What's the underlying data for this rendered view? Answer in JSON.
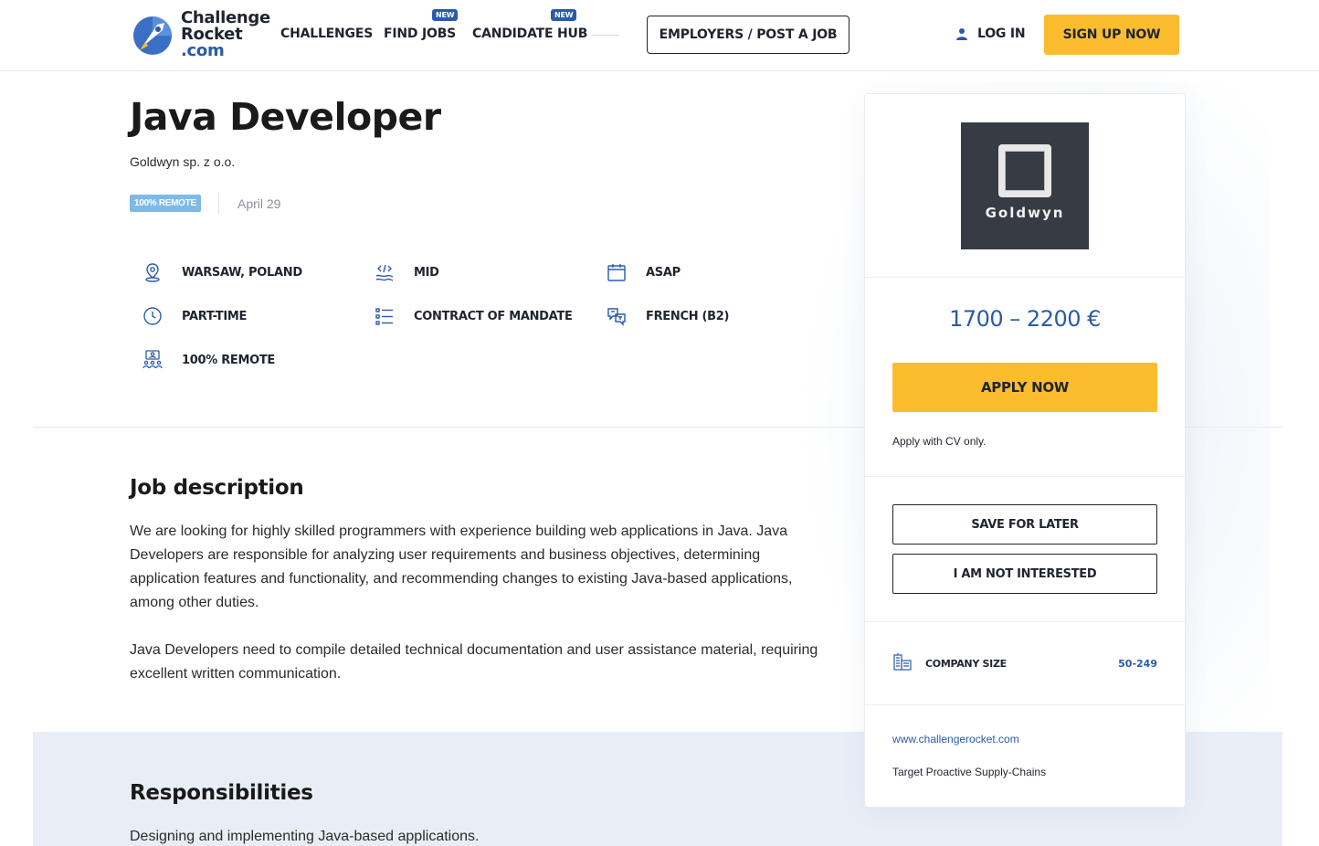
{
  "header": {
    "logo": {
      "line1": "Challenge",
      "line2": "Rocket",
      "line3": ".com"
    },
    "nav": [
      {
        "label": "CHALLENGES",
        "badge": ""
      },
      {
        "label": "FIND JOBS",
        "badge": "NEW"
      },
      {
        "label": "CANDIDATE HUB",
        "badge": "NEW"
      }
    ],
    "employers_label": "EMPLOYERS / POST A JOB",
    "login_label": "LOG IN",
    "signup_label": "SIGN UP NOW"
  },
  "job": {
    "title": "Java Developer",
    "company": "Goldwyn sp. z o.o.",
    "remote_badge": "100% REMOTE",
    "date": "April 29",
    "attributes": {
      "location": "WARSAW, POLAND",
      "seniority": "MID",
      "start": "ASAP",
      "employment": "PART-TIME",
      "contract": "CONTRACT OF MANDATE",
      "language": "FRENCH (B2)",
      "remote": "100% REMOTE"
    }
  },
  "description": {
    "heading": "Job description",
    "p1": "We are looking for highly skilled programmers with experience building web applications in Java. Java Developers are responsible for analyzing user requirements and business objectives, determining application features and functionality, and recommending changes to existing Java-based applications, among other duties.",
    "p2": "Java Developers need to compile detailed technical documentation and user assistance material, requiring excellent written communication."
  },
  "responsibilities": {
    "heading": "Responsibilities",
    "first_item": "Designing and implementing Java-based applications."
  },
  "sidebar": {
    "company_logo_text": "Goldwyn",
    "salary": "1700 – 2200 €",
    "apply_label": "APPLY NOW",
    "apply_note": "Apply with CV only.",
    "save_label": "SAVE FOR LATER",
    "not_interested_label": "I AM NOT INTERESTED",
    "company_size_label": "COMPANY SIZE",
    "company_size_value": "50-249",
    "website": "www.challengerocket.com",
    "tagline": "Target Proactive Supply-Chains"
  },
  "colors": {
    "accent_yellow": "#fbbd2d",
    "brand_blue": "#2a5ba8",
    "remote_badge": "#7fb9e6",
    "section_bg": "#e9eef6"
  }
}
